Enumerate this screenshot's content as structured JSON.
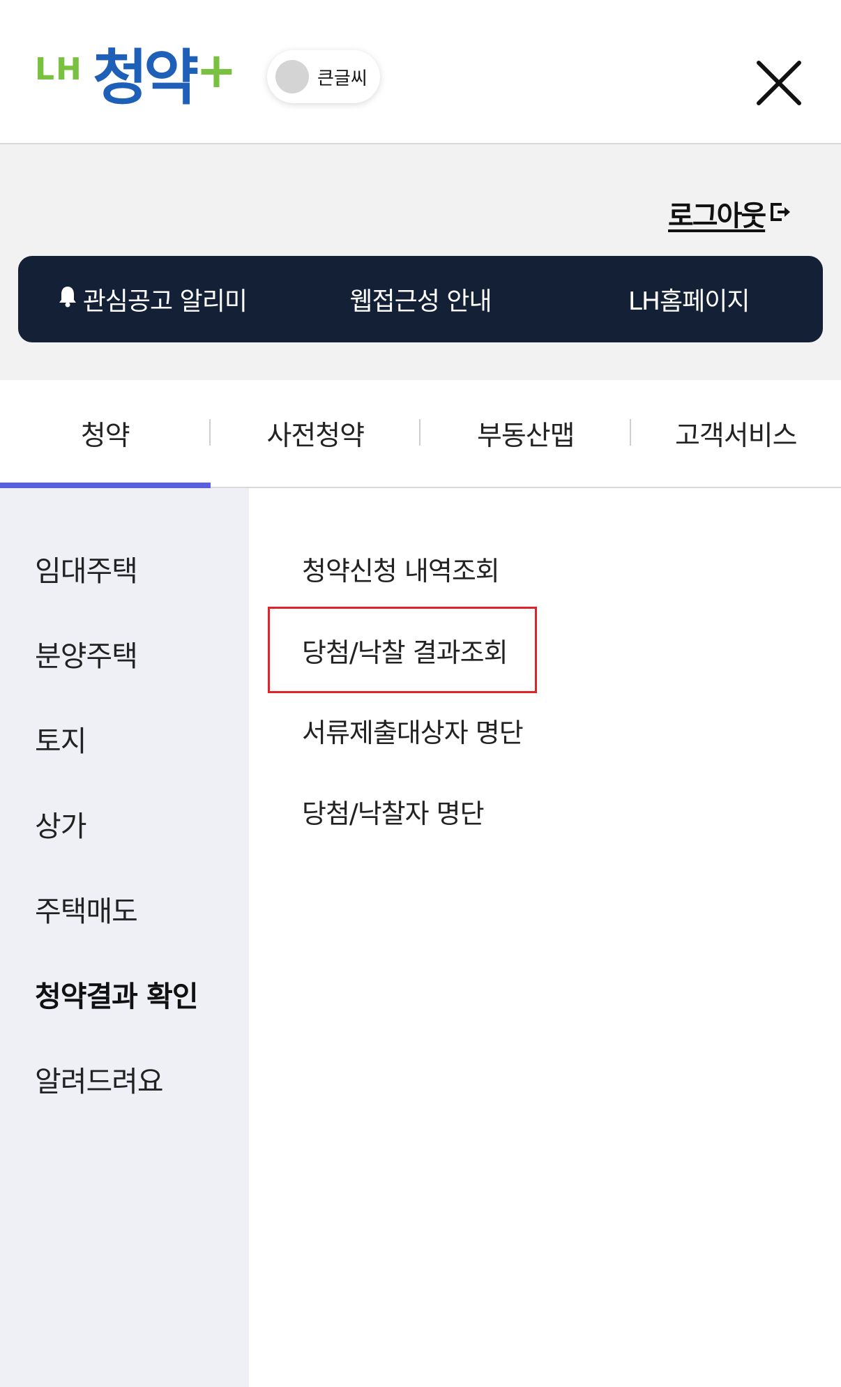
{
  "header": {
    "logo": {
      "prefix": "LH",
      "main": "청약",
      "plus": "+",
      "prefix_color": "#7ac142",
      "main_color": "#1e5fb7",
      "plus_color": "#7ac142"
    },
    "large_text_toggle": {
      "label": "큰글씨",
      "on": false
    },
    "close_icon": "close-icon"
  },
  "utility": {
    "logout_label": "로그아웃",
    "quick_links": [
      {
        "label": "관심공고 알리미",
        "icon": "bell-icon"
      },
      {
        "label": "웹접근성 안내"
      },
      {
        "label": "LH홈페이지"
      }
    ]
  },
  "tabs": [
    {
      "label": "청약",
      "active": true
    },
    {
      "label": "사전청약",
      "active": false
    },
    {
      "label": "부동산맵",
      "active": false
    },
    {
      "label": "고객서비스",
      "active": false
    }
  ],
  "sidebar": {
    "items": [
      {
        "label": "임대주택"
      },
      {
        "label": "분양주택"
      },
      {
        "label": "토지"
      },
      {
        "label": "상가"
      },
      {
        "label": "주택매도"
      },
      {
        "label": "청약결과 확인",
        "active": true
      },
      {
        "label": "알려드려요"
      }
    ]
  },
  "submenu": {
    "items": [
      {
        "label": "청약신청 내역조회"
      },
      {
        "label": "당첨/낙찰 결과조회",
        "highlighted": true
      },
      {
        "label": "서류제출대상자 명단"
      },
      {
        "label": "당첨/낙찰자 명단"
      }
    ]
  },
  "colors": {
    "accent": "#5a5fe0",
    "nav_dark": "#132035",
    "highlight": "#e0232b",
    "sidebar_bg": "#eef0f6"
  }
}
